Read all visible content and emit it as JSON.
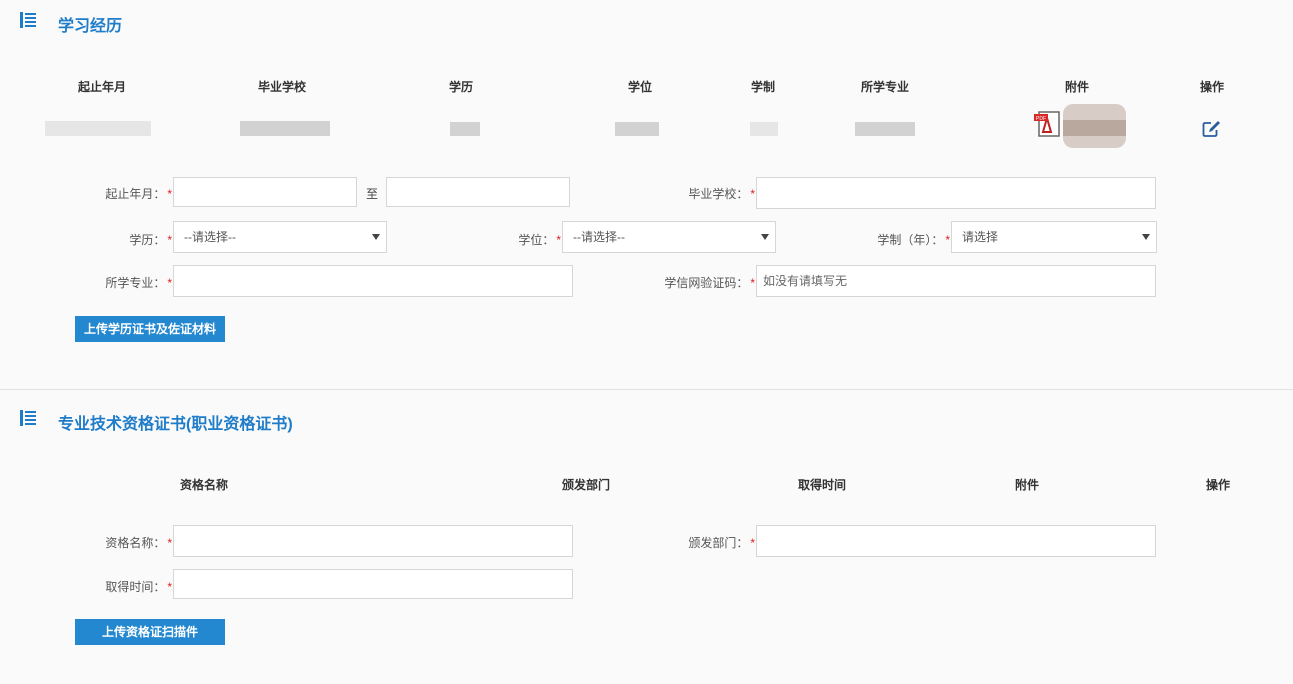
{
  "education": {
    "title": "学习经历",
    "headers": [
      "起止年月",
      "毕业学校",
      "学历",
      "学位",
      "学制",
      "所学专业",
      "附件",
      "操作"
    ],
    "form": {
      "period_label": "起止年月：",
      "period_sep": "至",
      "school_label": "毕业学校：",
      "degree_level_label": "学历：",
      "degree_level_value": "--请选择--",
      "degree_label": "学位：",
      "degree_value": "--请选择--",
      "duration_label": "学制（年）：",
      "duration_value": "请选择",
      "major_label": "所学专业：",
      "verify_label": "学信网验证码：",
      "verify_placeholder": "如没有请填写无",
      "upload_label": "上传学历证书及佐证材料"
    },
    "attachment_icon": "pdf-icon",
    "action_icon": "edit-icon"
  },
  "qualification": {
    "title": "专业技术资格证书(职业资格证书)",
    "headers": [
      "资格名称",
      "颁发部门",
      "取得时间",
      "附件",
      "操作"
    ],
    "form": {
      "name_label": "资格名称：",
      "dept_label": "颁发部门：",
      "time_label": "取得时间：",
      "upload_label": "上传资格证扫描件"
    }
  },
  "required_mark": "*",
  "colors": {
    "accent": "#1e7cc8",
    "button": "#2488d0",
    "required": "#e02020"
  }
}
